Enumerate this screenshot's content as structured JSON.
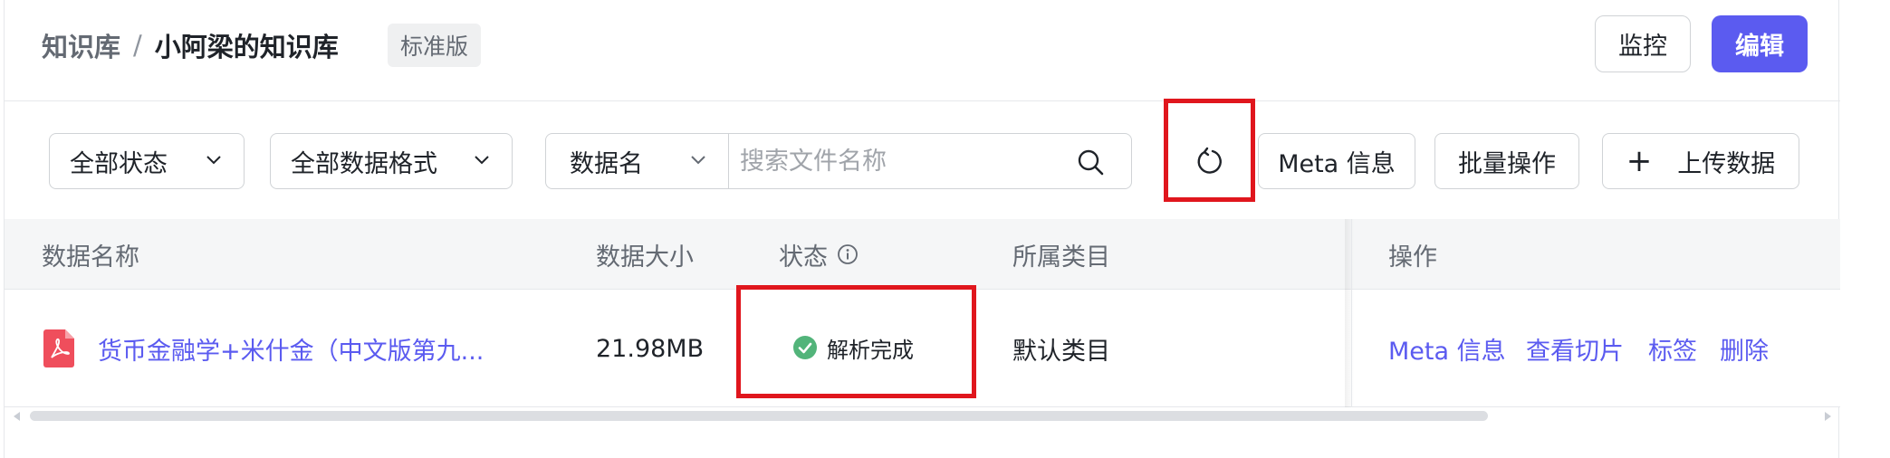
{
  "breadcrumb": {
    "root": "知识库",
    "separator": "/",
    "current": "小阿梁的知识库",
    "edition": "标准版"
  },
  "header_actions": {
    "monitor_label": "监控",
    "edit_label": "编辑"
  },
  "toolbar": {
    "status_filter": "全部状态",
    "format_filter": "全部数据格式",
    "search_type": "数据名",
    "search_placeholder": "搜索文件名称",
    "meta_label": "Meta 信息",
    "batch_label": "批量操作",
    "upload_icon": "+",
    "upload_label": "上传数据"
  },
  "table": {
    "columns": {
      "name": "数据名称",
      "size": "数据大小",
      "status": "状态",
      "category": "所属类目",
      "actions": "操作"
    },
    "rows": [
      {
        "name": "货币金融学+米什金（中文版第九...",
        "file_type_icon": "pdf-file-icon",
        "size": "21.98MB",
        "status": "解析完成",
        "category": "默认类目",
        "actions": {
          "meta": "Meta 信息",
          "chunks": "查看切片",
          "tags": "标签",
          "delete": "删除"
        }
      }
    ]
  },
  "colors": {
    "accent": "#5b5bf0",
    "highlight_box": "#e0161d",
    "success": "#52b47a",
    "pdf_icon": "#ef4e5c"
  }
}
